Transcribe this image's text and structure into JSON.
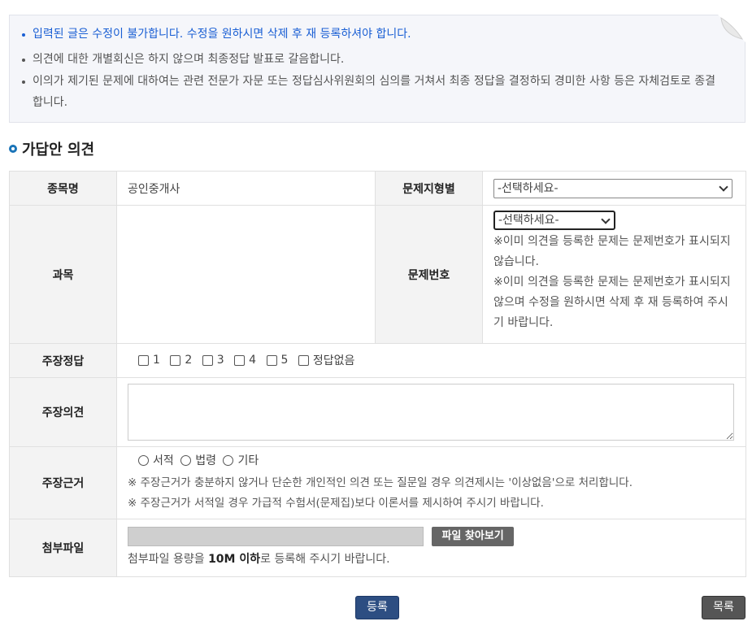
{
  "notice": {
    "items": [
      "입력된 글은 수정이 불가합니다. 수정을 원하시면 삭제 후 재 등록하셔야 합니다.",
      "의견에 대한 개별회신은 하지 않으며 최종정답 발표로 갈음합니다.",
      "이의가 제기된 문제에 대하여는 관련 전문가 자문 또는 정답심사위원회의 심의를 거쳐서 최종 정답을 결정하되 경미한 사항 등은 자체검토로 종결합니다."
    ],
    "accent_color": "#1a5fd4"
  },
  "section": {
    "title": "가답안 의견",
    "bullet_icon": "ring-bullet-icon"
  },
  "form": {
    "subject_label": "종목명",
    "subject_value": "공인중개사",
    "question_type_label": "문제지형별",
    "question_type_value": "-선택하세요-",
    "course_label": "과목",
    "question_no_label": "문제번호",
    "question_no_value": "-선택하세요-",
    "question_no_note1": "※이미 의견을 등록한 문제는 문제번호가 표시되지 않습니다.",
    "question_no_note2": "※이미 의견을 등록한 문제는 문제번호가 표시되지 않으며 수정을 원하시면 삭제 후 재 등록하여 주시기 바랍니다.",
    "claim_answer_label": "주장정답",
    "answer_options": [
      "1",
      "2",
      "3",
      "4",
      "5",
      "정답없음"
    ],
    "claim_opinion_label": "주장의견",
    "claim_basis_label": "주장근거",
    "basis_options": [
      "서적",
      "법령",
      "기타"
    ],
    "basis_note1": "※ 주장근거가 충분하지 않거나 단순한 개인적인 의견 또는 질문일 경우 의견제시는 '이상없음'으로 처리합니다.",
    "basis_note2": "※ 주장근거가 서적일 경우 가급적 수험서(문제집)보다 이론서를 제시하여 주시기 바랍니다.",
    "attach_label": "첨부파일",
    "attach_button": "파일 찾아보기",
    "attach_note_pre": "첨부파일 용량을 ",
    "attach_note_bold": "10M 이하",
    "attach_note_post": "로 등록해 주시기 바랍니다."
  },
  "buttons": {
    "submit": "등록",
    "list": "목록"
  }
}
